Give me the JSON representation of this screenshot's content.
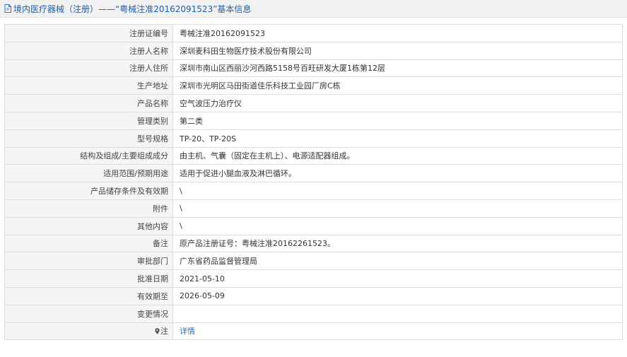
{
  "header": {
    "title": "境内医疗器械（注册）——“粤械注准20162091523”基本信息",
    "icon": "document-icon"
  },
  "rows": [
    {
      "label": "注册证编号",
      "value": "粤械注准20162091523"
    },
    {
      "label": "注册人名称",
      "value": "深圳麦科田生物医疗技术股份有限公司"
    },
    {
      "label": "注册人住所",
      "value": "深圳市南山区西丽沙河西路5158号百旺研发大厦1栋第12层"
    },
    {
      "label": "生产地址",
      "value": "深圳市光明区马田街道佳乐科技工业园厂房C栋"
    },
    {
      "label": "产品名称",
      "value": "空气波压力治疗仪"
    },
    {
      "label": "管理类别",
      "value": "第二类"
    },
    {
      "label": "型号规格",
      "value": "TP-20、TP-20S"
    },
    {
      "label": "结构及组成/主要组成成分",
      "value": "由主机、气囊（固定在主机上）、电源适配器组成。"
    },
    {
      "label": "适用范围/预期用途",
      "value": "适用于促进小腿血液及淋巴循环。"
    },
    {
      "label": "产品储存条件及有效期",
      "value": "\\"
    },
    {
      "label": "附件",
      "value": "\\"
    },
    {
      "label": "其他内容",
      "value": "\\"
    },
    {
      "label": "备注",
      "value": "原产品注册证号：粤械注准20162261523。"
    },
    {
      "label": "审批部门",
      "value": "广东省药品监督管理局"
    },
    {
      "label": "批准日期",
      "value": "2021-05-10"
    },
    {
      "label": "有效期至",
      "value": "2026-05-09"
    },
    {
      "label": "变更情况",
      "value": ""
    }
  ],
  "note_row": {
    "label": "注",
    "icon": "map-pin-icon",
    "link_text": "详情"
  },
  "colors": {
    "header_bg": "#f1f1f1",
    "title_blue": "#1f5fa8",
    "link_blue": "#2a6ebb",
    "label_bg": "#f5f5f5",
    "border": "#dcdcdc"
  }
}
